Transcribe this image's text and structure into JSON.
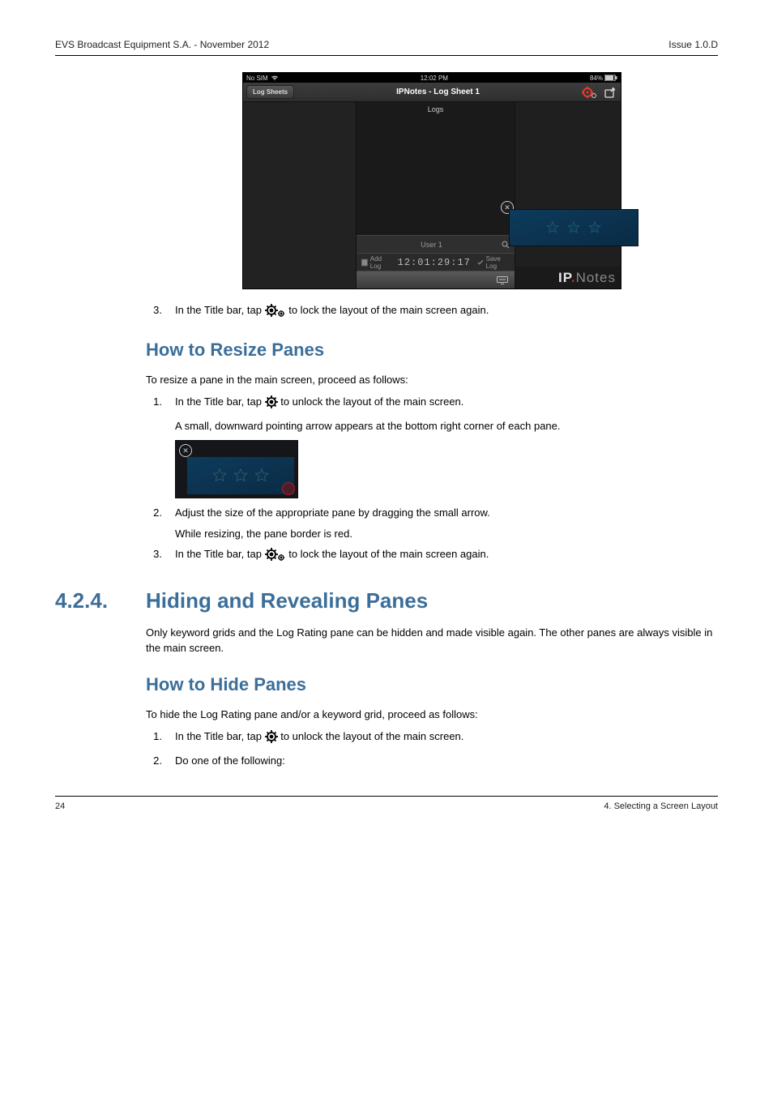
{
  "header": {
    "left": "EVS Broadcast Equipment S.A. - November 2012",
    "right": "Issue 1.0.D"
  },
  "screenshot": {
    "status": {
      "carrier": "No SIM",
      "time": "12:02 PM",
      "battery": "84%"
    },
    "titlebar": {
      "back": "Log Sheets",
      "title": "IPNotes - Log Sheet 1"
    },
    "logs_label": "Logs",
    "user_row": "User 1",
    "add_log": "Add Log",
    "timecode": "12:01:29:17",
    "save_log": "Save Log",
    "brand": {
      "ip": "IP",
      "notes": "Notes"
    }
  },
  "step3a": "In the Title bar, tap ",
  "step3b": " to lock the layout of the main screen again.",
  "sec1": {
    "title": "How to Resize Panes",
    "intro": "To resize a pane in the main screen, proceed as follows:",
    "s1a": "In the Title bar, tap ",
    "s1b": " to unlock the layout of the main screen.",
    "s1c": "A small, downward pointing arrow appears at the bottom right corner of each pane.",
    "s2a": "Adjust the size of the appropriate pane by dragging the small arrow.",
    "s2b": "While resizing, the pane border is red.",
    "s3a": "In the Title bar, tap ",
    "s3b": " to lock the layout of the main screen again."
  },
  "sec2": {
    "num": "4.2.4.",
    "title": "Hiding and Revealing Panes",
    "intro": "Only keyword grids and the Log Rating pane can be hidden and made visible again. The other panes are always visible in the main screen.",
    "h3": "How to Hide Panes",
    "intro2": "To hide the Log Rating pane and/or a keyword grid, proceed as follows:",
    "s1a": "In the Title bar, tap ",
    "s1b": " to unlock the layout of the main screen.",
    "s2": "Do one of the following:"
  },
  "footer": {
    "page": "24",
    "section": "4. Selecting a Screen Layout"
  }
}
